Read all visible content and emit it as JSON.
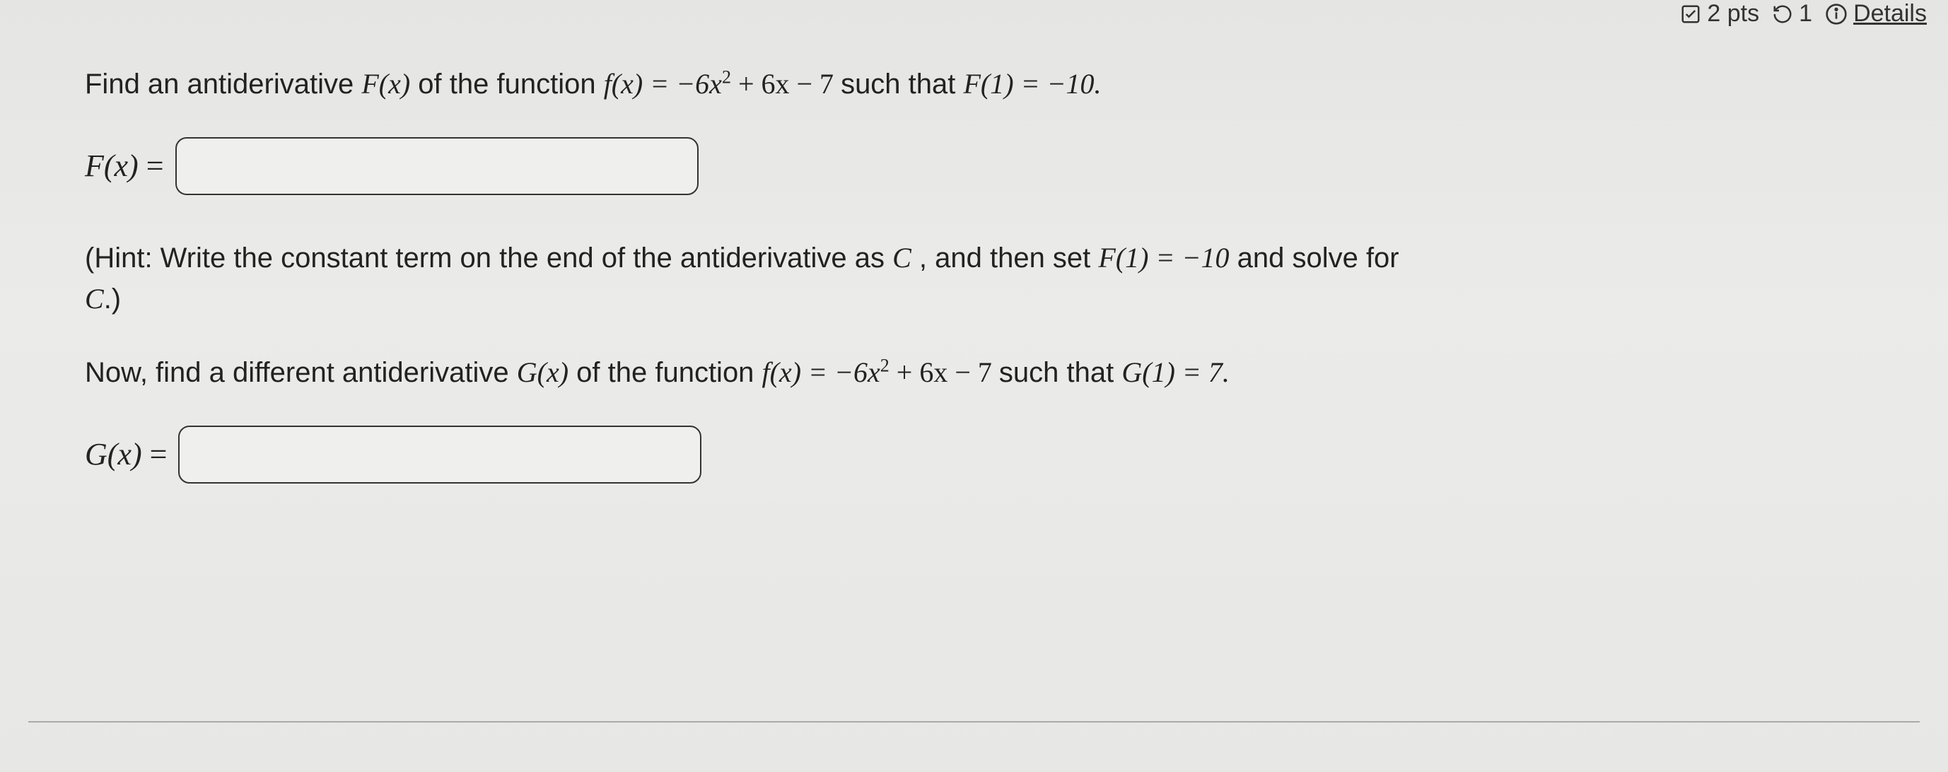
{
  "header": {
    "points": "2 pts",
    "attempts": "1",
    "details_label": "Details"
  },
  "question": {
    "prompt_pre": "Find an antiderivative ",
    "F_of_x": "F(x)",
    "prompt_mid": " of the function ",
    "f_eq": "f(x) = −6x",
    "sq": "2",
    "f_eq_tail": " + 6x − 7",
    "such_that": " such that ",
    "cond1": "F(1) = −10.",
    "input1_label_a": "F(x)",
    "input1_label_b": " =",
    "hint_pre": "(Hint: Write the constant term on the end of the antiderivative as ",
    "hint_C": "C",
    "hint_mid": ", and then set ",
    "hint_cond": "F(1) = −10",
    "hint_tail": " and solve for ",
    "hint_C2": "C",
    "hint_close": ".)",
    "prompt2_pre": "Now, find a different antiderivative ",
    "G_of_x": "G(x)",
    "prompt2_mid": " of the function ",
    "cond2": "G(1) = 7.",
    "input2_label_a": "G(x)",
    "input2_label_b": " ="
  }
}
